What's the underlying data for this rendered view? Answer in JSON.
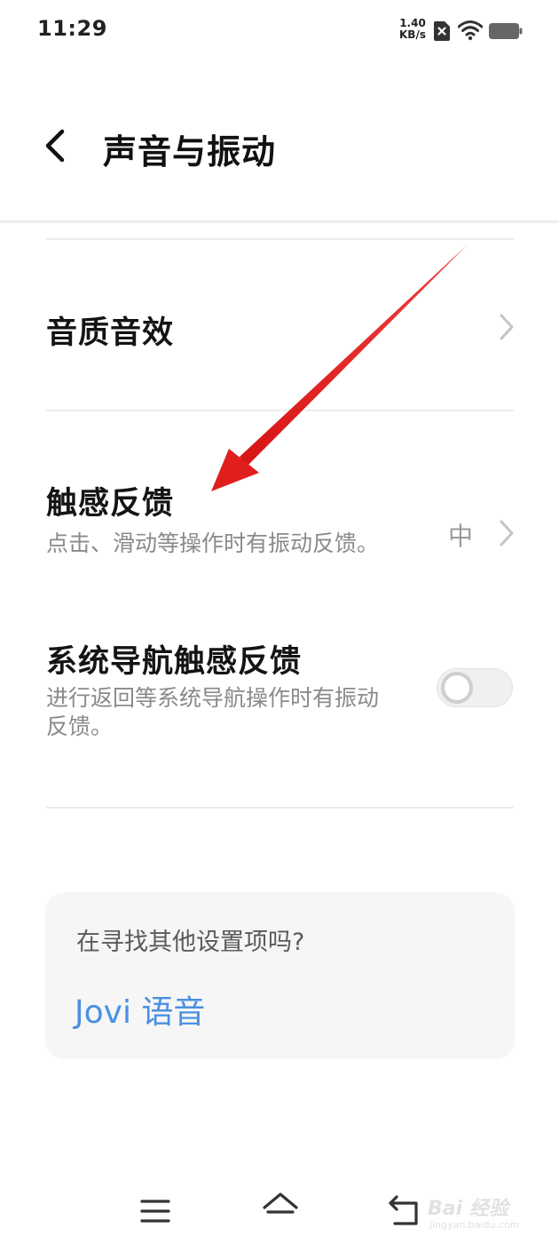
{
  "status_bar": {
    "time": "11:29",
    "net_speed_value": "1.40",
    "net_speed_unit": "KB/s"
  },
  "header": {
    "title": "声音与振动"
  },
  "settings": {
    "sound_quality": {
      "title": "音质音效"
    },
    "haptic_feedback": {
      "title": "触感反馈",
      "description": "点击、滑动等操作时有振动反馈。",
      "value": "中"
    },
    "nav_haptic_feedback": {
      "title": "系统导航触感反馈",
      "description": "进行返回等系统导航操作时有振动反馈。",
      "enabled": false
    }
  },
  "search_card": {
    "question": "在寻找其他设置项吗?",
    "link": "Jovi 语音"
  },
  "watermark": {
    "text": "Bai 经验",
    "sub": "jingyan.baidu.com"
  },
  "colors": {
    "accent_link": "#4a90e2",
    "annotation_arrow": "#e01e1e"
  },
  "icons": [
    "sim-icon",
    "wifi-icon",
    "battery-icon",
    "back-icon",
    "chevron-right-icon",
    "menu-icon",
    "home-icon",
    "back-nav-icon",
    "annotation-arrow"
  ]
}
